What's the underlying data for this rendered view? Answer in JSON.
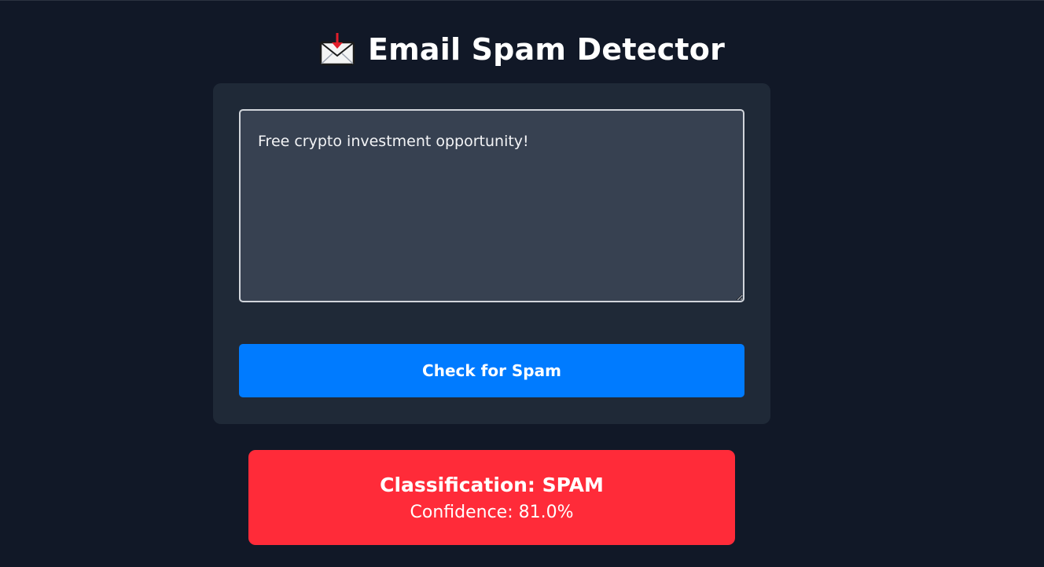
{
  "header": {
    "icon": "incoming-envelope-icon",
    "title": "Email Spam Detector"
  },
  "form": {
    "email_text": "Free crypto investment opportunity!",
    "button_label": "Check for Spam"
  },
  "result": {
    "classification_text": "Classification: SPAM",
    "confidence_text": "Confidence: 81.0%"
  },
  "colors": {
    "background": "#111827",
    "card": "#1f2937",
    "textarea": "#374151",
    "button": "#007bff",
    "result_spam": "#ff2b39"
  }
}
